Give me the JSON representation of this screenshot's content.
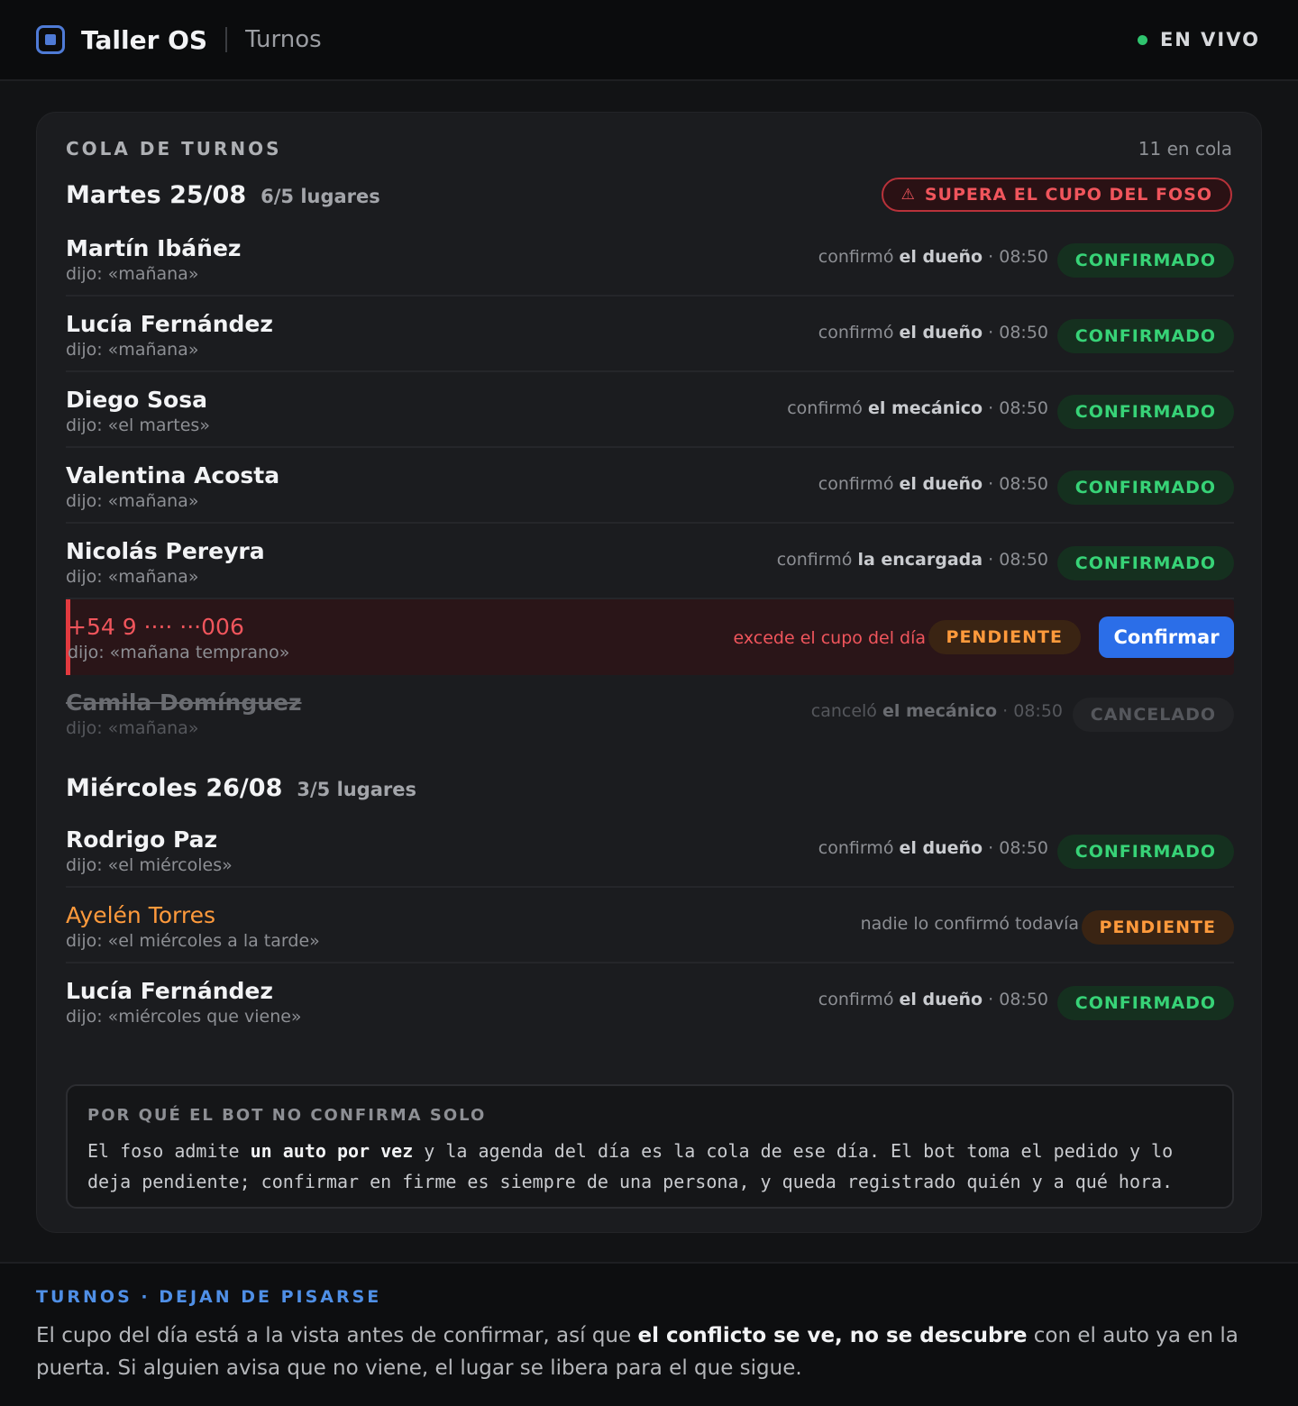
{
  "app": {
    "name": "Taller OS",
    "section": "Turnos",
    "live_label": "EN VIVO"
  },
  "queue": {
    "title": "COLA DE TURNOS",
    "count": "11 en cola"
  },
  "days": [
    {
      "name": "Martes 25/08",
      "capacity": "6/5 lugares",
      "alert": "SUPERA EL CUPO DEL FOSO",
      "rows": [
        {
          "name": "Martín Ibáñez",
          "said": "dijo: «mañana»",
          "meta_pre": "confirmó",
          "meta_who": "el dueño",
          "meta_time": "· 08:50",
          "status": "CONFIRMADO"
        },
        {
          "name": "Lucía Fernández",
          "said": "dijo: «mañana»",
          "meta_pre": "confirmó",
          "meta_who": "el dueño",
          "meta_time": "· 08:50",
          "status": "CONFIRMADO"
        },
        {
          "name": "Diego Sosa",
          "said": "dijo: «el martes»",
          "meta_pre": "confirmó",
          "meta_who": "el mecánico",
          "meta_time": "· 08:50",
          "status": "CONFIRMADO"
        },
        {
          "name": "Valentina Acosta",
          "said": "dijo: «mañana»",
          "meta_pre": "confirmó",
          "meta_who": "el dueño",
          "meta_time": "· 08:50",
          "status": "CONFIRMADO"
        },
        {
          "name": "Nicolás Pereyra",
          "said": "dijo: «mañana»",
          "meta_pre": "confirmó",
          "meta_who": "la encargada",
          "meta_time": "· 08:50",
          "status": "CONFIRMADO"
        },
        {
          "name": "+54 9 ···· ···006",
          "said": "dijo: «mañana temprano»",
          "warning": "excede el cupo del día",
          "status": "PENDIENTE",
          "action": "Confirmar"
        },
        {
          "name": "Camila Domínguez",
          "said": "dijo: «mañana»",
          "meta_pre": "canceló",
          "meta_who": "el mecánico",
          "meta_time": "· 08:50",
          "status": "CANCELADO"
        }
      ]
    },
    {
      "name": "Miércoles 26/08",
      "capacity": "3/5 lugares",
      "rows": [
        {
          "name": "Rodrigo Paz",
          "said": "dijo: «el miércoles»",
          "meta_pre": "confirmó",
          "meta_who": "el dueño",
          "meta_time": "· 08:50",
          "status": "CONFIRMADO"
        },
        {
          "name": "Ayelén Torres",
          "said": "dijo: «el miércoles a la tarde»",
          "meta_pre": "nadie lo confirmó todavía",
          "status": "PENDIENTE"
        },
        {
          "name": "Lucía Fernández",
          "said": "dijo: «miércoles que viene»",
          "meta_pre": "confirmó",
          "meta_who": "el dueño",
          "meta_time": "· 08:50",
          "status": "CONFIRMADO"
        }
      ]
    }
  ],
  "note": {
    "title": "POR QUÉ EL BOT NO CONFIRMA SOLO",
    "p1": "El foso admite ",
    "p2": "un auto por vez",
    "p3": " y la agenda del día es la cola de ese día. El bot toma el pedido y lo deja pendiente; confirmar en firme es siempre de una persona, y queda registrado quién y a qué hora."
  },
  "footer": {
    "title": "TURNOS · DEJAN DE PISARSE",
    "p1": "El cupo del día está a la vista antes de confirmar, así que ",
    "p2": "el conflicto se ve, no se descubre",
    "p3": " con el auto ya en la puerta. Si alguien avisa que no viene, el lugar se libera para el que sigue."
  },
  "colors": {
    "accent": "#2b6ee8",
    "ok": "#37d377",
    "pending": "#ff9a3c",
    "danger": "#f0555c",
    "live": "#2fc46e"
  },
  "icons": {
    "logo": "square-app-icon",
    "alert": "warning-triangle-icon",
    "live": "live-dot-icon"
  }
}
